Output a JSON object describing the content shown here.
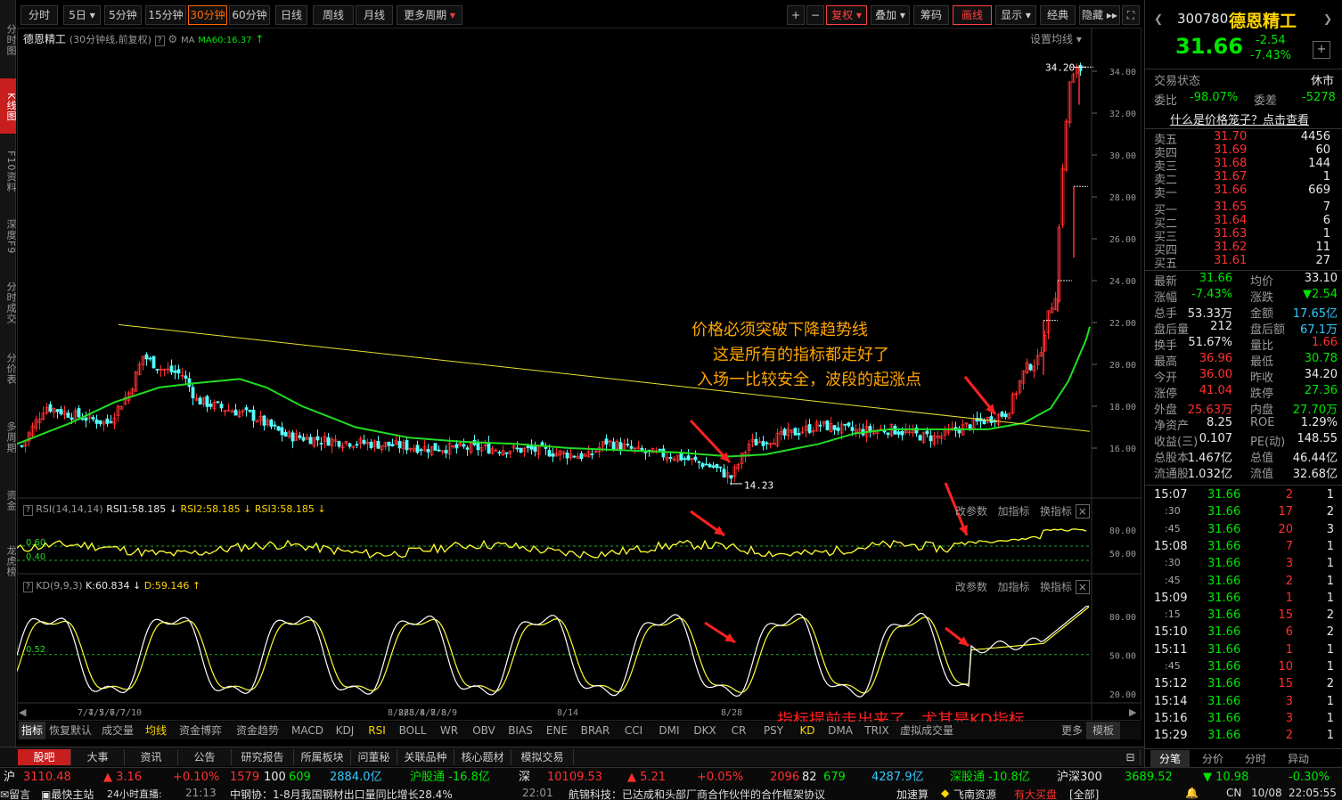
{
  "left_nav": [
    "分时图",
    "K线图",
    "F10资料",
    "深度F9",
    "分时成交",
    "分价表",
    "多周期",
    "资金",
    "龙虎榜"
  ],
  "toolbar": {
    "periods": [
      "分时",
      "5日",
      "5分钟",
      "15分钟",
      "30分钟",
      "60分钟",
      "日线",
      "周线",
      "月线",
      "更多周期"
    ],
    "active_period": "30分钟",
    "right_buttons": [
      "复权",
      "叠加",
      "筹码",
      "画线",
      "显示",
      "经典",
      "隐藏"
    ]
  },
  "chart": {
    "title": "德恩精工",
    "subtitle": "(30分钟线,前复权)",
    "ma_label": "MA",
    "ma60": "MA60:16.37",
    "set_ma": "设置均线",
    "price_axis": [
      "34.00",
      "32.00",
      "30.00",
      "28.00",
      "26.00",
      "24.00",
      "22.00",
      "20.00",
      "18.00",
      "16.00"
    ],
    "high_label": "34.20",
    "low_label": "14.23",
    "annotations": [
      "价格必须突破下降趋势线",
      "这是所有的指标都走好了",
      "入场一比较安全，波段的起涨点"
    ],
    "bottom_note": "指标提前走出来了，尤其是KD指标",
    "dates": [
      "7/4",
      "7/5",
      "7/6",
      "7/7",
      "7/10",
      "8/28",
      "8/3",
      "8/4",
      "8/7",
      "8/8",
      "8/9",
      "8/14",
      "8/28"
    ],
    "rsi": {
      "label": "RSI(14,14,14)",
      "rsi1": "RSI1:58.185",
      "rsi2": "RSI2:58.185",
      "rsi3": "RSI3:58.185",
      "axis": [
        "80.00",
        "50.00"
      ],
      "levels": [
        "0.60",
        "0.40"
      ],
      "actions": [
        "改参数",
        "加指标",
        "换指标"
      ]
    },
    "kd": {
      "label": "KD(9,9,3)",
      "k": "K:60.834",
      "d": "D:59.146",
      "axis": [
        "80.00",
        "50.00",
        "20.00"
      ],
      "level": "0.52",
      "actions": [
        "改参数",
        "加指标",
        "换指标"
      ]
    }
  },
  "bottom_tabs": [
    "指标",
    "恢复默认",
    "成交量",
    "均线",
    "资金博弈",
    "资金趋势",
    "MACD",
    "KDJ",
    "RSI",
    "BOLL",
    "WR",
    "OBV",
    "BIAS",
    "ENE",
    "BRAR",
    "CCI",
    "DMI",
    "DKX",
    "CR",
    "PSY",
    "KD",
    "DMA",
    "TRIX",
    "虚拟成交量",
    "更多",
    "模板"
  ],
  "news_tabs": [
    "股吧",
    "大事",
    "资讯",
    "公告",
    "研究报告",
    "所属板块",
    "问董秘",
    "关联品种",
    "核心题材",
    "模拟交易"
  ],
  "status": {
    "sh_index": "3110.48",
    "sh_chg": "▲ 3.16",
    "sh_pct": "+0.10%",
    "sh_up": "1579",
    "sh_flat": "100",
    "sh_down": "609",
    "sh_amt": "2884.0亿",
    "hgt": "沪股通 -16.8亿",
    "sz_label": "深",
    "sz_index": "10109.53",
    "sz_chg": "▲ 5.21",
    "sz_pct": "+0.05%",
    "sz_up": "2096",
    "sz_flat": "82",
    "sz_down": "679",
    "sz_amt": "4287.9亿",
    "sgt": "深股通 -10.8亿",
    "hs300": "沪深300",
    "hs300_val": "3689.52",
    "hs300_chg": "▼ 10.98",
    "hs300_pct": "-0.30%"
  },
  "ticker": {
    "items": [
      "留言",
      "最快主站",
      "24小时直播:",
      "21:13",
      "中钢协：1-8月我国钢材出口量同比增长28.4%",
      "22:01",
      "航锦科技：已达成和头部厂商合作伙伴的合作框架协议",
      "加速算",
      "飞南资源",
      "有大买盘",
      "[全部]"
    ],
    "region": "CN",
    "date": "10/08",
    "time": "22:05:55"
  },
  "quote": {
    "code": "300780",
    "name": "德恩精工",
    "price": "31.66",
    "chg": "-2.54",
    "pct": "-7.43%",
    "trade_state_label": "交易状态",
    "trade_state": "休市",
    "weibi_label": "委比",
    "weibi": "-98.07%",
    "weicha_label": "委差",
    "weicha": "-5278",
    "link": "什么是价格笼子？点击查看",
    "sells": [
      [
        "卖五",
        "31.70",
        "4456"
      ],
      [
        "卖四",
        "31.69",
        "60"
      ],
      [
        "卖三",
        "31.68",
        "144"
      ],
      [
        "卖二",
        "31.67",
        "1"
      ],
      [
        "卖一",
        "31.66",
        "669"
      ]
    ],
    "buys": [
      [
        "买一",
        "31.65",
        "7"
      ],
      [
        "买二",
        "31.64",
        "6"
      ],
      [
        "买三",
        "31.63",
        "1"
      ],
      [
        "买四",
        "31.62",
        "11"
      ],
      [
        "买五",
        "31.61",
        "27"
      ]
    ],
    "stats": [
      [
        "最新",
        "31.66",
        "均价",
        "33.10"
      ],
      [
        "涨幅",
        "-7.43%",
        "涨跌",
        "▼2.54"
      ],
      [
        "总手",
        "53.33万",
        "金额",
        "17.65亿"
      ],
      [
        "盘后量",
        "212",
        "盘后额",
        "67.1万"
      ],
      [
        "换手",
        "51.67%",
        "量比",
        "1.66"
      ],
      [
        "最高",
        "36.96",
        "最低",
        "30.78"
      ],
      [
        "今开",
        "36.00",
        "昨收",
        "34.20"
      ],
      [
        "涨停",
        "41.04",
        "跌停",
        "27.36"
      ],
      [
        "外盘",
        "25.63万",
        "内盘",
        "27.70万"
      ],
      [
        "净资产",
        "8.25",
        "ROE",
        "1.29%"
      ],
      [
        "收益(三)",
        "0.107",
        "PE(动)",
        "148.55"
      ],
      [
        "总股本",
        "1.467亿",
        "总值",
        "46.44亿"
      ],
      [
        "流通股",
        "1.032亿",
        "流值",
        "32.68亿"
      ]
    ],
    "trades": [
      [
        "15:07",
        "31.66",
        "2",
        "1"
      ],
      [
        ":30",
        "31.66",
        "17",
        "2"
      ],
      [
        ":45",
        "31.66",
        "20",
        "3"
      ],
      [
        "15:08",
        "31.66",
        "7",
        "1"
      ],
      [
        ":30",
        "31.66",
        "3",
        "1"
      ],
      [
        ":45",
        "31.66",
        "2",
        "1"
      ],
      [
        "15:09",
        "31.66",
        "1",
        "1"
      ],
      [
        ":15",
        "31.66",
        "15",
        "2"
      ],
      [
        "15:10",
        "31.66",
        "6",
        "2"
      ],
      [
        "15:11",
        "31.66",
        "1",
        "1"
      ],
      [
        ":45",
        "31.66",
        "10",
        "1"
      ],
      [
        "15:12",
        "31.66",
        "15",
        "2"
      ],
      [
        "15:14",
        "31.66",
        "3",
        "1"
      ],
      [
        "15:16",
        "31.66",
        "3",
        "1"
      ],
      [
        "15:29",
        "31.66",
        "2",
        "1"
      ]
    ],
    "tabs": [
      "分笔",
      "分价",
      "分时",
      "异动"
    ]
  }
}
